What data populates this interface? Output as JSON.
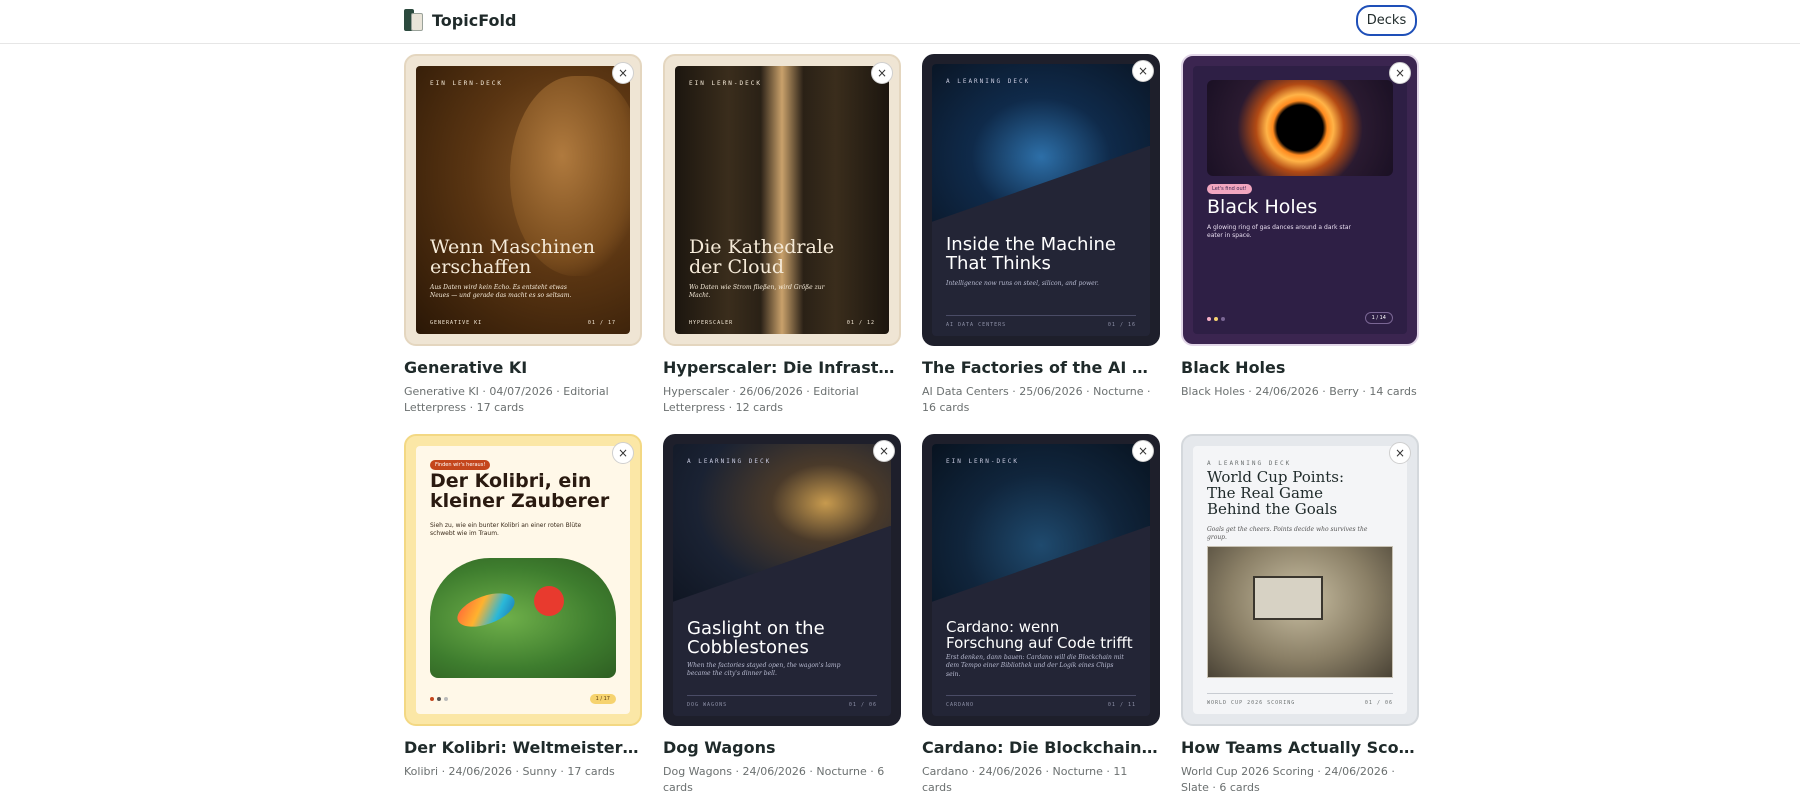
{
  "header": {
    "brand": "TopicFold",
    "decks_button": "Decks"
  },
  "close_glyph": "×",
  "decks": [
    {
      "title": "Generative KI",
      "meta": "Generative KI · 04/07/2026 · Editorial Letterpress · 17 cards",
      "cover": {
        "kicker": "EIN LERN-DECK",
        "title": "Wenn Maschinen erschaffen",
        "subtitle": "Aus Daten wird kein Echo. Es entsteht etwas Neues — und gerade das macht es so seltsam.",
        "footer_left": "GENERATIVE KI",
        "footer_right": "01 / 17"
      }
    },
    {
      "title": "Hyperscaler: Die Infrastruktur...",
      "meta": "Hyperscaler · 26/06/2026 · Editorial Letterpress · 12 cards",
      "cover": {
        "kicker": "EIN LERN-DECK",
        "title": "Die Kathedrale der Cloud",
        "subtitle": "Wo Daten wie Strom fließen, wird Größe zur Macht.",
        "footer_left": "HYPERSCALER",
        "footer_right": "01 / 12"
      }
    },
    {
      "title": "The Factories of the AI Age",
      "meta": "AI Data Centers · 25/06/2026 · Nocturne · 16 cards",
      "cover": {
        "kicker": "A LEARNING DECK",
        "title": "Inside the Machine That Thinks",
        "subtitle": "Intelligence now runs on steel, silicon, and power.",
        "footer_left": "AI DATA CENTERS",
        "footer_right": "01 / 16"
      }
    },
    {
      "title": "Black Holes",
      "meta": "Black Holes · 24/06/2026 · Berry · 14 cards",
      "cover": {
        "tag": "Let's find out!",
        "title": "Black Holes",
        "subtitle": "A glowing ring of gas dances around a dark star eater in space.",
        "pager": "1 / 14"
      }
    },
    {
      "title": "Der Kolibri: Weltmeister im S...",
      "meta": "Kolibri · 24/06/2026 · Sunny · 17 cards",
      "cover": {
        "tag": "Finden wir's heraus!",
        "title": "Der Kolibri, ein kleiner Zauberer",
        "subtitle": "Sieh zu, wie ein bunter Kolibri an einer roten Blüte schwebt wie im Traum.",
        "pager": "1 / 17"
      }
    },
    {
      "title": "Dog Wagons",
      "meta": "Dog Wagons · 24/06/2026 · Nocturne · 6 cards",
      "cover": {
        "kicker": "A LEARNING DECK",
        "title": "Gaslight on the Cobblestones",
        "subtitle": "When the factories stayed open, the wagon's lamp became the city's dinner bell.",
        "footer_left": "DOG WAGONS",
        "footer_right": "01 / 06"
      }
    },
    {
      "title": "Cardano: Die Blockchain, die ...",
      "meta": "Cardano · 24/06/2026 · Nocturne · 11 cards",
      "cover": {
        "kicker": "EIN LERN-DECK",
        "title": "Cardano: wenn Forschung auf Code trifft",
        "subtitle": "Erst denken, dann bauen: Cardano will die Blockchain mit dem Tempo einer Bibliothek und der Logik eines Chips sein.",
        "footer_left": "CARDANO",
        "footer_right": "01 / 11"
      }
    },
    {
      "title": "How Teams Actually Score Po...",
      "meta": "World Cup 2026 Scoring · 24/06/2026 · Slate · 6 cards",
      "cover": {
        "kicker": "A LEARNING DECK",
        "title": "World Cup Points: The Real Game Behind the Goals",
        "subtitle": "Goals get the cheers. Points decide who survives the group.",
        "footer_left": "WORLD CUP 2026 SCORING",
        "footer_right": "01 / 06"
      }
    }
  ]
}
